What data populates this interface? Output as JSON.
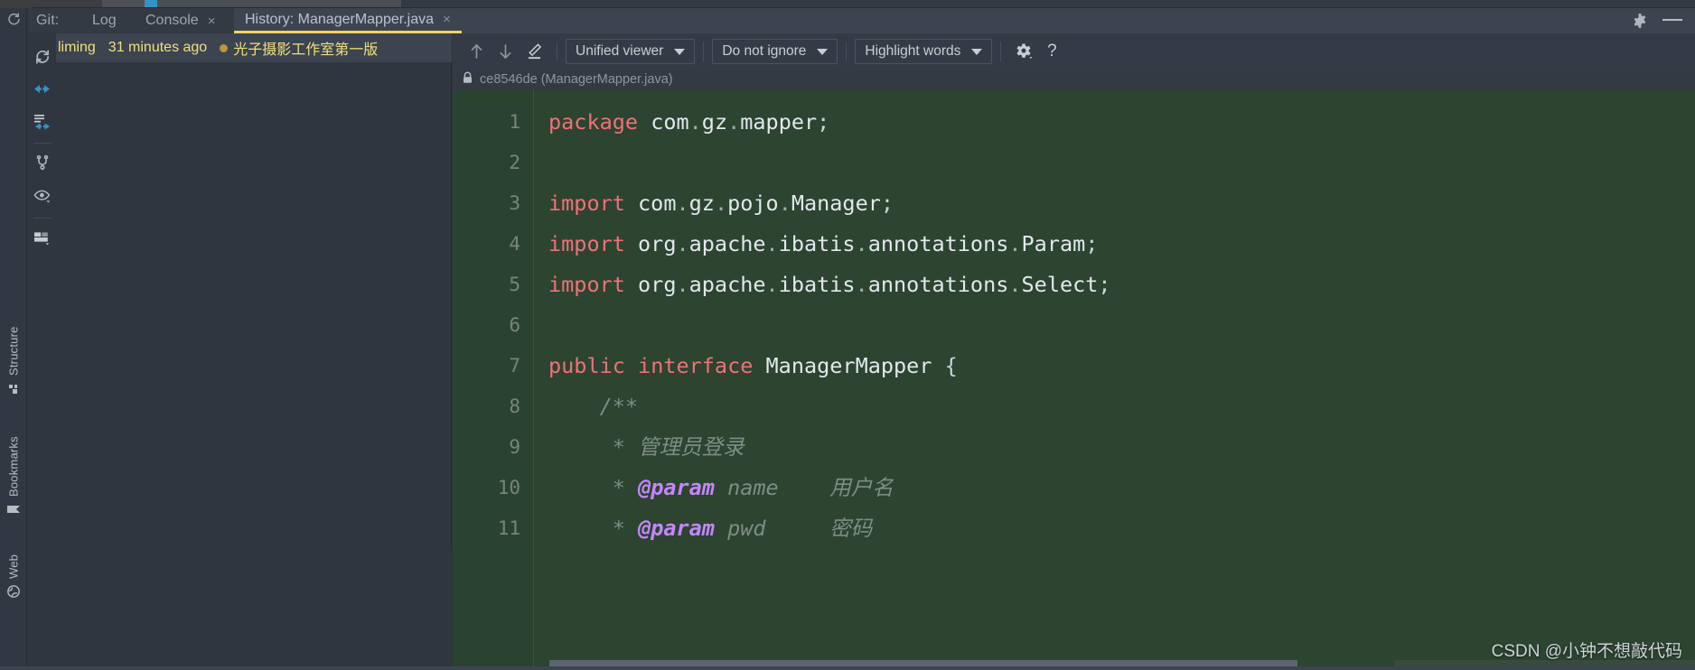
{
  "window": {
    "controls": {
      "settings_icon": "gear-icon",
      "minimize_icon": "minimize-icon"
    }
  },
  "left_rail": {
    "refresh_icon": "refresh-icon",
    "tools": [
      {
        "label": "Structure",
        "icon": "structure-icon"
      },
      {
        "label": "Bookmarks",
        "icon": "bookmark-icon"
      },
      {
        "label": "Web",
        "icon": "web-globe-icon"
      }
    ]
  },
  "git_panel": {
    "title": "Git:",
    "tabs": [
      {
        "label": "Log",
        "closable": false,
        "active": false
      },
      {
        "label": "Console",
        "closable": true,
        "close": "×",
        "active": false
      },
      {
        "label": "History: ManagerMapper.java",
        "closable": true,
        "close": "×",
        "active": true
      }
    ],
    "actions": [
      {
        "icon": "refresh-icon",
        "name": "refresh-button"
      },
      {
        "icon": "collapse-arrows-icon",
        "name": "collapse-all-button"
      },
      {
        "icon": "expand-list-icon",
        "name": "group-collapse-button"
      },
      {
        "icon": "branch-icon",
        "name": "show-branches-button"
      },
      {
        "icon": "eye-icon",
        "name": "show-hide-button"
      },
      {
        "icon": "layout-icon",
        "name": "view-options-button"
      }
    ],
    "commit": {
      "author": "liming",
      "time": "31 minutes ago",
      "dot_color": "#b9973f",
      "message": "光子摄影工作室第一版"
    }
  },
  "diff": {
    "toolbar": {
      "prev_change_icon": "arrow-up-icon",
      "next_change_icon": "arrow-down-icon",
      "edit_icon": "pencil-edit-icon",
      "viewer_mode": "Unified viewer",
      "whitespace": "Do not ignore",
      "highlight": "Highlight words",
      "settings_icon": "gear-icon",
      "help_icon": "help-question-icon",
      "caret_icon": "chevron-down-icon"
    },
    "file_header": {
      "lock_icon": "lock-icon",
      "text": "ce8546de (ManagerMapper.java)"
    },
    "editor": {
      "background_color": "#2c4430",
      "gutter_color": "#2a4330",
      "lines": [
        {
          "num": "1",
          "tokens": [
            {
              "t": "package",
              "c": "kw"
            },
            {
              "t": " com",
              "c": "plain"
            },
            {
              "t": ".",
              "c": "dot"
            },
            {
              "t": "gz",
              "c": "plain"
            },
            {
              "t": ".",
              "c": "dot"
            },
            {
              "t": "mapper",
              "c": "plain"
            },
            {
              "t": ";",
              "c": "punc"
            }
          ]
        },
        {
          "num": "2",
          "tokens": []
        },
        {
          "num": "3",
          "tokens": [
            {
              "t": "import",
              "c": "kw"
            },
            {
              "t": " com",
              "c": "plain"
            },
            {
              "t": ".",
              "c": "dot"
            },
            {
              "t": "gz",
              "c": "plain"
            },
            {
              "t": ".",
              "c": "dot"
            },
            {
              "t": "pojo",
              "c": "plain"
            },
            {
              "t": ".",
              "c": "dot"
            },
            {
              "t": "Manager",
              "c": "plain"
            },
            {
              "t": ";",
              "c": "punc"
            }
          ]
        },
        {
          "num": "4",
          "tokens": [
            {
              "t": "import",
              "c": "kw"
            },
            {
              "t": " org",
              "c": "plain"
            },
            {
              "t": ".",
              "c": "dot"
            },
            {
              "t": "apache",
              "c": "plain"
            },
            {
              "t": ".",
              "c": "dot"
            },
            {
              "t": "ibatis",
              "c": "plain"
            },
            {
              "t": ".",
              "c": "dot"
            },
            {
              "t": "annotations",
              "c": "plain"
            },
            {
              "t": ".",
              "c": "dot"
            },
            {
              "t": "Param",
              "c": "plain"
            },
            {
              "t": ";",
              "c": "punc"
            }
          ]
        },
        {
          "num": "5",
          "tokens": [
            {
              "t": "import",
              "c": "kw"
            },
            {
              "t": " org",
              "c": "plain"
            },
            {
              "t": ".",
              "c": "dot"
            },
            {
              "t": "apache",
              "c": "plain"
            },
            {
              "t": ".",
              "c": "dot"
            },
            {
              "t": "ibatis",
              "c": "plain"
            },
            {
              "t": ".",
              "c": "dot"
            },
            {
              "t": "annotations",
              "c": "plain"
            },
            {
              "t": ".",
              "c": "dot"
            },
            {
              "t": "Select",
              "c": "plain"
            },
            {
              "t": ";",
              "c": "punc"
            }
          ]
        },
        {
          "num": "6",
          "tokens": []
        },
        {
          "num": "7",
          "tokens": [
            {
              "t": "public",
              "c": "kw"
            },
            {
              "t": " ",
              "c": "plain"
            },
            {
              "t": "interface",
              "c": "kw"
            },
            {
              "t": " ManagerMapper",
              "c": "plain"
            },
            {
              "t": " {",
              "c": "punc"
            }
          ]
        },
        {
          "num": "8",
          "tokens": [
            {
              "t": "    /**",
              "c": "cmt"
            }
          ]
        },
        {
          "num": "9",
          "tokens": [
            {
              "t": "     * 管理员登录",
              "c": "cmt"
            }
          ]
        },
        {
          "num": "10",
          "tokens": [
            {
              "t": "     * ",
              "c": "cmt"
            },
            {
              "t": "@param",
              "c": "tag"
            },
            {
              "t": " name    用户名",
              "c": "cmt"
            }
          ]
        },
        {
          "num": "11",
          "tokens": [
            {
              "t": "     * ",
              "c": "cmt"
            },
            {
              "t": "@param",
              "c": "tag"
            },
            {
              "t": " pwd     密码",
              "c": "cmt"
            }
          ]
        }
      ]
    }
  },
  "watermark": "CSDN @小钟不想敲代码"
}
